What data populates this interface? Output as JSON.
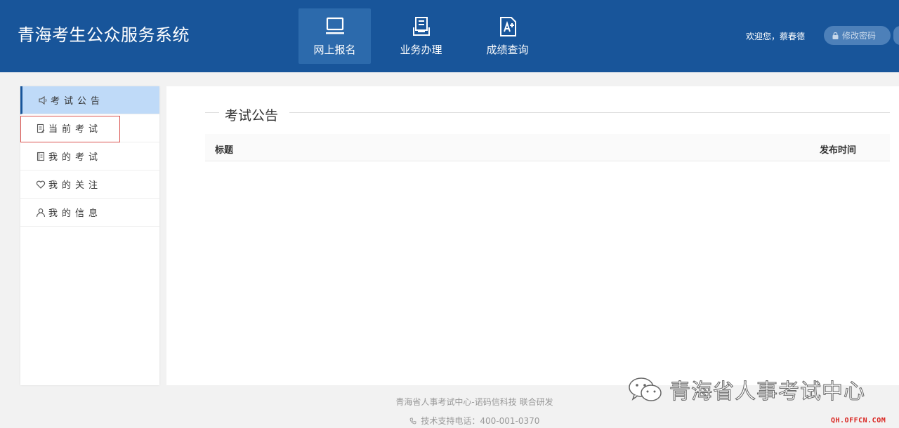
{
  "header": {
    "app_title": "青海考生公众服务系统",
    "nav": [
      {
        "label": "网上报名",
        "icon": "laptop-icon",
        "active": true
      },
      {
        "label": "业务办理",
        "icon": "document-stack-icon",
        "active": false
      },
      {
        "label": "成绩查询",
        "icon": "grade-report-icon",
        "active": false
      }
    ],
    "welcome": "欢迎您，蔡春德",
    "change_password": "修改密码"
  },
  "sidebar": {
    "items": [
      {
        "label": "考试公告",
        "icon": "speaker-icon",
        "active": true
      },
      {
        "label": "当前考试",
        "icon": "edit-document-icon",
        "active": false,
        "highlighted": true
      },
      {
        "label": "我的考试",
        "icon": "notebook-icon",
        "active": false
      },
      {
        "label": "我的关注",
        "icon": "heart-icon",
        "active": false
      },
      {
        "label": "我的信息",
        "icon": "user-icon",
        "active": false
      }
    ]
  },
  "main": {
    "section_title": "考试公告",
    "table": {
      "columns": [
        "标题",
        "发布时间"
      ],
      "rows": []
    }
  },
  "footer": {
    "credits": "青海省人事考试中心-诺码信科技 联合研发",
    "support": "技术支持电话：400-001-0370"
  },
  "watermark": {
    "text": "青海省人事考试中心",
    "site": "QH.OFFCN.COM"
  },
  "colors": {
    "header_bg": "#18559a",
    "active_nav_bg": "#2c6aac",
    "sidebar_active_bg": "#bfdaf8",
    "highlight_border": "#d9534f"
  }
}
